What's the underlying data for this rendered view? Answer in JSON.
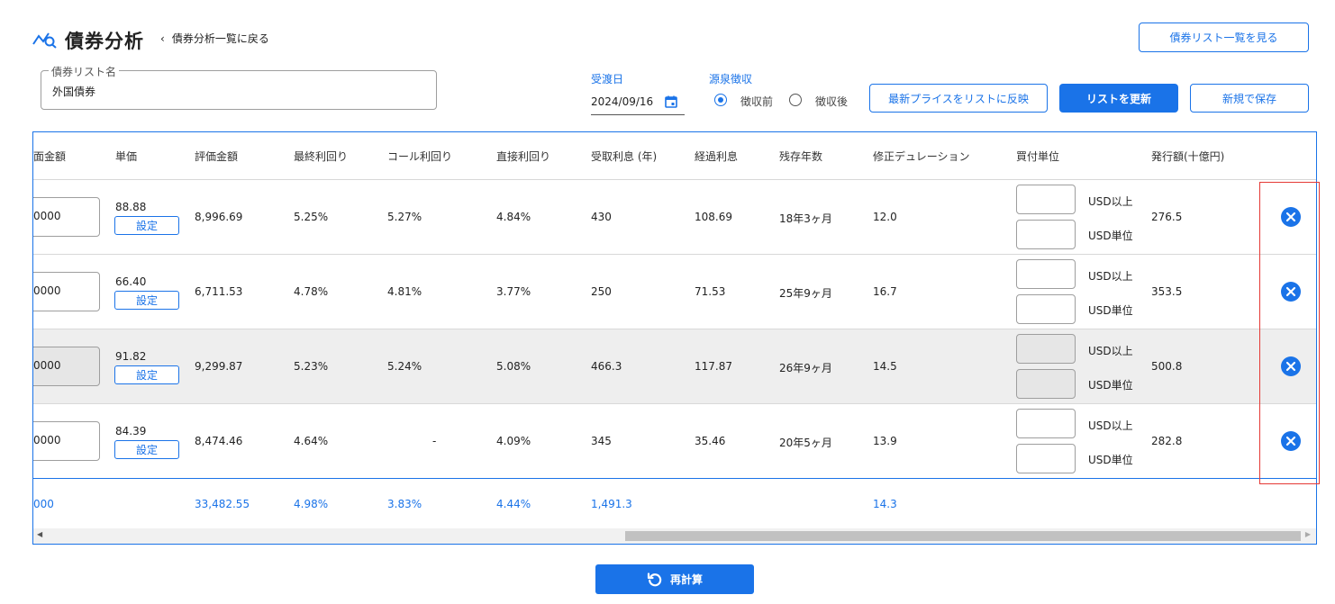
{
  "header": {
    "title": "債券分析",
    "back_label": "債券分析一覧に戻る",
    "view_list_button": "債券リスト一覧を見る"
  },
  "form": {
    "list_name_label": "債券リスト名",
    "list_name_value": "外国債券",
    "settlement_label": "受渡日",
    "settlement_date": "2024/09/16",
    "withholding_label": "源泉徴収",
    "radio_before": "徴収前",
    "radio_after": "徴収後",
    "radio_selected": "徴収前"
  },
  "actions": {
    "reflect_price": "最新プライスをリストに反映",
    "update_list": "リストを更新",
    "save_new": "新規で保存",
    "recalc": "再計算"
  },
  "table": {
    "columns": [
      "面金額",
      "単価",
      "評価金額",
      "最終利回り",
      "コール利回り",
      "直接利回り",
      "受取利息 (年)",
      "経過利息",
      "残存年数",
      "修正デュレーション",
      "買付単位",
      "発行額(十億円)"
    ],
    "set_label": "設定",
    "unit_min_label": "USD以上",
    "unit_step_label": "USD単位",
    "rows": [
      {
        "amount": "0000",
        "price": "88.88",
        "valuation": "8,996.69",
        "ytm": "5.25%",
        "call_yield": "5.27%",
        "current_yield": "4.84%",
        "annual_interest": "430",
        "accrued": "108.69",
        "remaining": "18年3ヶ月",
        "duration": "12.0",
        "issue": "276.5",
        "shaded": false
      },
      {
        "amount": "0000",
        "price": "66.40",
        "valuation": "6,711.53",
        "ytm": "4.78%",
        "call_yield": "4.81%",
        "current_yield": "3.77%",
        "annual_interest": "250",
        "accrued": "71.53",
        "remaining": "25年9ヶ月",
        "duration": "16.7",
        "issue": "353.5",
        "shaded": false
      },
      {
        "amount": "0000",
        "price": "91.82",
        "valuation": "9,299.87",
        "ytm": "5.23%",
        "call_yield": "5.24%",
        "current_yield": "5.08%",
        "annual_interest": "466.3",
        "accrued": "117.87",
        "remaining": "26年9ヶ月",
        "duration": "14.5",
        "issue": "500.8",
        "shaded": true
      },
      {
        "amount": "0000",
        "price": "84.39",
        "valuation": "8,474.46",
        "ytm": "4.64%",
        "call_yield": "-",
        "current_yield": "4.09%",
        "annual_interest": "345",
        "accrued": "35.46",
        "remaining": "20年5ヶ月",
        "duration": "13.9",
        "issue": "282.8",
        "shaded": false
      }
    ],
    "totals": {
      "amount": "000",
      "valuation": "33,482.55",
      "ytm": "4.98%",
      "call_yield": "3.83%",
      "current_yield": "4.44%",
      "annual_interest": "1,491.3",
      "duration": "14.3"
    }
  },
  "colors": {
    "accent": "#1a73e8",
    "highlight": "#e53935",
    "shaded_row": "#eeeeee"
  }
}
